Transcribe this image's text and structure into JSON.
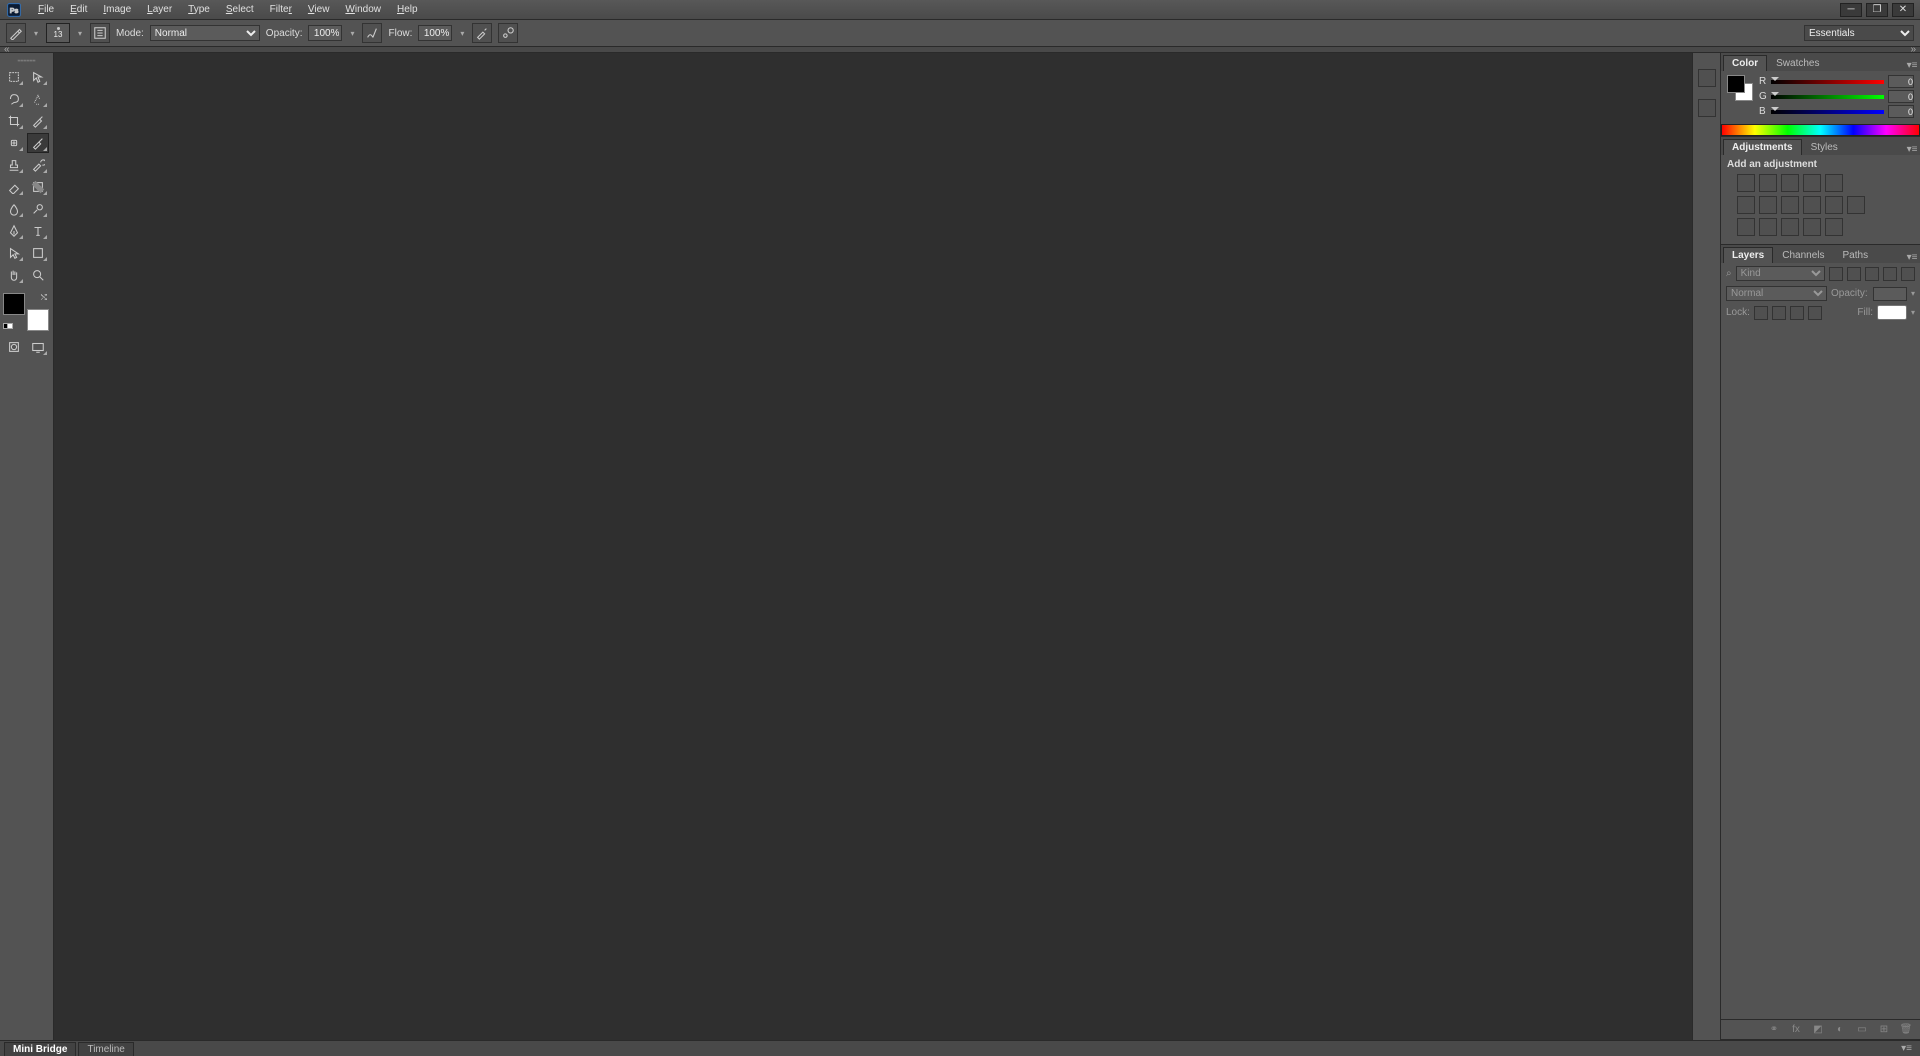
{
  "app": {
    "logo": "Ps"
  },
  "menu": [
    "File",
    "Edit",
    "Image",
    "Layer",
    "Type",
    "Select",
    "Filter",
    "View",
    "Window",
    "Help"
  ],
  "options": {
    "brush_size": "13",
    "mode_label": "Mode:",
    "mode_value": "Normal",
    "opacity_label": "Opacity:",
    "opacity_value": "100%",
    "flow_label": "Flow:",
    "flow_value": "100%",
    "workspace": "Essentials"
  },
  "color": {
    "tabs": [
      "Color",
      "Swatches"
    ],
    "channels": [
      {
        "label": "R",
        "value": "0"
      },
      {
        "label": "G",
        "value": "0"
      },
      {
        "label": "B",
        "value": "0"
      }
    ],
    "fg": "#000000",
    "bg": "#ffffff"
  },
  "adjustments": {
    "tabs": [
      "Adjustments",
      "Styles"
    ],
    "title": "Add an adjustment"
  },
  "layers": {
    "tabs": [
      "Layers",
      "Channels",
      "Paths"
    ],
    "kind_label": "Kind",
    "blend_mode": "Normal",
    "opacity_label": "Opacity:",
    "opacity_value": "",
    "lock_label": "Lock:",
    "fill_label": "Fill:",
    "fill_value": ""
  },
  "bottom": {
    "tabs": [
      "Mini Bridge",
      "Timeline"
    ]
  },
  "tools": [
    [
      "marquee",
      "move"
    ],
    [
      "lasso",
      "quick-select"
    ],
    [
      "crop",
      "eyedropper"
    ],
    [
      "healing",
      "brush"
    ],
    [
      "stamp",
      "history-brush"
    ],
    [
      "eraser",
      "gradient"
    ],
    [
      "blur",
      "dodge"
    ],
    [
      "pen",
      "type"
    ],
    [
      "path-select",
      "shape"
    ],
    [
      "hand",
      "zoom"
    ]
  ]
}
